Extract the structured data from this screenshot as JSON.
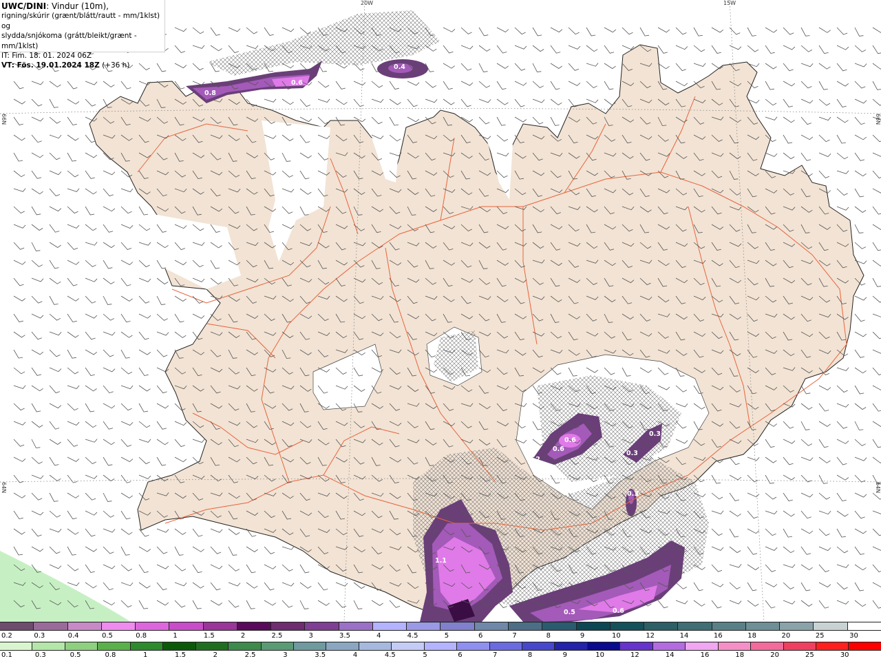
{
  "header": {
    "model": "UWC/DINI",
    "line1_rest": ": Vindur (10m),",
    "line2": "rigning/skúrir (grænt/blátt/rautt - mm/1klst) og",
    "line3": "slydda/snjókoma (grátt/bleikt/grænt - mm/1klst)",
    "line4": "IT: Fim. 18. 01. 2024 06Z",
    "line5_bold": "VT: Fös. 19.01.2024 18Z",
    "line5_rest": " (+36 h)"
  },
  "grid_labels": {
    "lon_20w": "20W",
    "lon_15w": "15W",
    "lat_66_left": "66N",
    "lat_66_right": "66N",
    "lat_64_left": "64N",
    "lat_64_right": "64N"
  },
  "precip_labels": [
    "0.4",
    "0.6",
    "0.8",
    "0.6",
    "0.6",
    "0.2",
    "0.3",
    "0.3",
    "0.3",
    "1.1",
    "0.5",
    "0.6"
  ],
  "snow_scale": {
    "labels": [
      "0.2",
      "0.3",
      "0.4",
      "0.5",
      "0.8",
      "1",
      "1.5",
      "2",
      "2.5",
      "3",
      "3.5",
      "4",
      "4.5",
      "5",
      "6",
      "7",
      "8",
      "9",
      "10",
      "12",
      "14",
      "16",
      "18",
      "20",
      "25",
      "30"
    ],
    "colors": [
      "#6e4c6e",
      "#9a6b9a",
      "#c78ac7",
      "#ef8bef",
      "#dd66dd",
      "#c84dc8",
      "#9a359a",
      "#5a0a5a",
      "#6e2d6e",
      "#7f3f93",
      "#9a71c7",
      "#b3b3ff",
      "#9999e6",
      "#8080cc",
      "#6f87a8",
      "#4c6e87",
      "#2b5b6e",
      "#0d4754",
      "#15515a",
      "#2d5f66",
      "#3f6e75",
      "#5a8087",
      "#6e8f96",
      "#8aa3a8",
      "#c8d2d3",
      "#ffffff"
    ]
  },
  "rain_scale": {
    "labels": [
      "0.1",
      "0.3",
      "0.5",
      "0.8",
      "1",
      "1.5",
      "2",
      "2.5",
      "3",
      "3.5",
      "4",
      "4.5",
      "5",
      "6",
      "7",
      "8",
      "9",
      "10",
      "12",
      "14",
      "16",
      "18",
      "20",
      "25",
      "30"
    ],
    "colors": [
      "#d8f5d0",
      "#b3e6a8",
      "#8fd080",
      "#5ab04a",
      "#2d8a2d",
      "#0a5a0a",
      "#1f6e1f",
      "#3d8a4c",
      "#5a9a75",
      "#6f9aa0",
      "#8aa6c0",
      "#a6b8dd",
      "#c4ccf5",
      "#b3b3ff",
      "#8f8ff0",
      "#6b6be0",
      "#4747cc",
      "#2222aa",
      "#0a0a8f",
      "#6633cc",
      "#b36be0",
      "#f0a6f0",
      "#f58fc8",
      "#f26b9a",
      "#f04060",
      "#ff2020",
      "#ff0000"
    ]
  },
  "colors": {
    "land": "#f2e3d4",
    "roads": "#e8643c",
    "glacier": "#ffffff",
    "sea": "#ffffff",
    "precip_purple_dark": "#6a3f78",
    "precip_purple_mid": "#a35ab8",
    "precip_purple_light": "#e07ae8",
    "rain_green": "#c2f0c0"
  }
}
